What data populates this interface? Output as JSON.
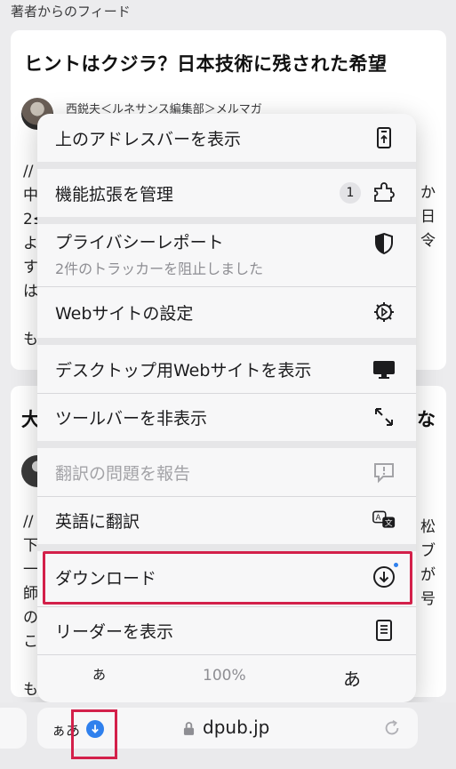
{
  "feed": {
    "header": "著者からのフィード",
    "card1": {
      "title": "ヒントはクジラ？日本技術に残された希望",
      "author": "西鋭夫＜ルネサンス編集部＞メルマガ",
      "text_left": "//\n中\n2≤\nよ\nす\nは\n\nも",
      "text_right": "か\n日\n令"
    },
    "card2": {
      "title_left": "大",
      "title_right": "な",
      "text_left": "//\n下\n一\n師\nの\nこ\n\nも",
      "text_right": "松\nブ\nが\n号"
    }
  },
  "menu": {
    "show_address_bar_top": "上のアドレスバーを表示",
    "manage_extensions": "機能拡張を管理",
    "extensions_count": "1",
    "privacy_report": "プライバシーレポート",
    "privacy_report_sub": "2件のトラッカーを阻止しました",
    "website_settings": "Webサイトの設定",
    "request_desktop": "デスクトップ用Webサイトを表示",
    "hide_toolbar": "ツールバーを非表示",
    "report_translation": "翻訳の問題を報告",
    "translate_english": "英語に翻訳",
    "downloads": "ダウンロード",
    "show_reader": "リーダーを表示",
    "zoom_small": "あ",
    "zoom_percent": "100%",
    "zoom_large": "あ"
  },
  "address_bar": {
    "aa_label": "ぁあ",
    "url": "dpub.jp"
  },
  "icons": {
    "address_bar_top": "address-bar-top-icon",
    "extensions": "puzzle-piece-icon",
    "privacy": "shield-icon",
    "settings": "gear-icon",
    "desktop": "desktop-monitor-icon",
    "hide_toolbar": "arrows-diagonal-icon",
    "report": "speech-bubble-exclamation-icon",
    "translate": "translate-bubble-icon",
    "download": "download-circle-icon",
    "reader": "reader-document-icon",
    "lock": "lock-icon",
    "reload": "reload-icon"
  },
  "colors": {
    "highlight": "#d3204a",
    "accent": "#2f80ed"
  }
}
